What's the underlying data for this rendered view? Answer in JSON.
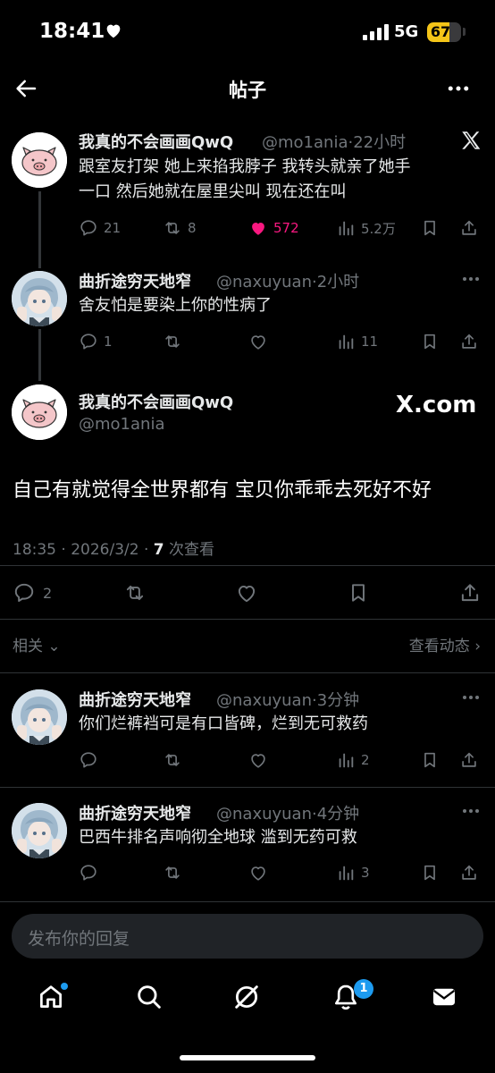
{
  "status": {
    "time": "18:41",
    "network": "5G",
    "battery": "67",
    "battery_level": 0.67
  },
  "nav": {
    "title": "帖子"
  },
  "thread": [
    {
      "name": "我真的不会画画QwQ",
      "handle": "@mo1ania",
      "time": "·22小时",
      "text_lines": [
        "跟室友打架 她上来掐我脖子 我转头就亲了她手",
        "一口 然后她就在屋里尖叫 现在还在叫"
      ],
      "replies": "21",
      "reposts": "8",
      "likes": "572",
      "views": "5.2万"
    },
    {
      "name": "曲折途穷天地窄",
      "handle": "@naxuyuan",
      "time": "·2小时",
      "text": "舍友怕是要染上你的性病了",
      "replies": "1",
      "views": "11"
    }
  ],
  "main": {
    "name": "我真的不会画画QwQ",
    "handle": "@mo1ania",
    "source": "X.com",
    "text": "自己有就觉得全世界都有 宝贝你乖乖去死好不好",
    "date": "18:35 · 2026/3/2 · ",
    "views_count": "7",
    "views_label": " 次查看",
    "replies": "2"
  },
  "related": {
    "label": "相关",
    "see_activity": "查看动态"
  },
  "replies": [
    {
      "name": "曲折途穷天地窄",
      "handle": "@naxuyuan",
      "time": "·3分钟",
      "text": "你们烂裤裆可是有口皆碑，烂到无可救药",
      "views": "2"
    },
    {
      "name": "曲折途穷天地窄",
      "handle": "@naxuyuan",
      "time": "·4分钟",
      "text": "巴西牛排名声响彻全地球 滥到无药可救",
      "views": "3"
    }
  ],
  "composer": {
    "placeholder": "发布你的回复"
  },
  "tabs": {
    "notifications_badge": "1"
  },
  "colors": {
    "like": "#f91880",
    "accent": "#1d9bf0",
    "muted": "#71767b"
  }
}
